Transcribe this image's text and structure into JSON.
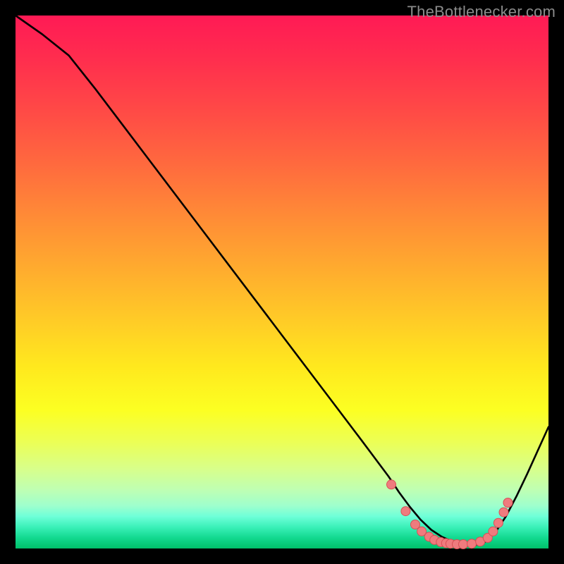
{
  "watermark": "TheBottlenecker.com",
  "colors": {
    "curve": "#000000",
    "dot_fill": "#ef7b7e",
    "dot_stroke": "#d94f55"
  },
  "chart_data": {
    "type": "line",
    "title": "",
    "xlabel": "",
    "ylabel": "",
    "xlim": [
      0,
      100
    ],
    "ylim": [
      0,
      100
    ],
    "series": [
      {
        "name": "curve",
        "x": [
          0,
          5,
          10,
          15,
          20,
          25,
          30,
          35,
          40,
          45,
          50,
          55,
          60,
          65,
          70,
          72,
          74,
          76,
          78,
          80,
          82,
          84,
          86,
          88,
          90,
          92,
          94,
          96,
          98,
          100
        ],
        "y": [
          100,
          96.5,
          92.5,
          86.2,
          79.6,
          73.0,
          66.4,
          59.8,
          53.2,
          46.6,
          40.0,
          33.4,
          26.8,
          20.2,
          13.5,
          10.5,
          7.8,
          5.4,
          3.5,
          2.2,
          1.3,
          0.8,
          0.6,
          1.2,
          3.0,
          6.0,
          9.8,
          14.0,
          18.4,
          22.8
        ]
      }
    ],
    "points": {
      "name": "cluster",
      "x": [
        70.5,
        73.2,
        75.0,
        76.2,
        77.6,
        78.6,
        79.8,
        80.8,
        81.6,
        82.8,
        84.0,
        85.6,
        87.2,
        88.6,
        89.6,
        90.6,
        91.6,
        92.4
      ],
      "y": [
        12.0,
        7.0,
        4.5,
        3.2,
        2.2,
        1.6,
        1.2,
        1.0,
        0.9,
        0.8,
        0.8,
        0.9,
        1.3,
        2.0,
        3.2,
        4.8,
        6.8,
        8.6
      ]
    }
  }
}
